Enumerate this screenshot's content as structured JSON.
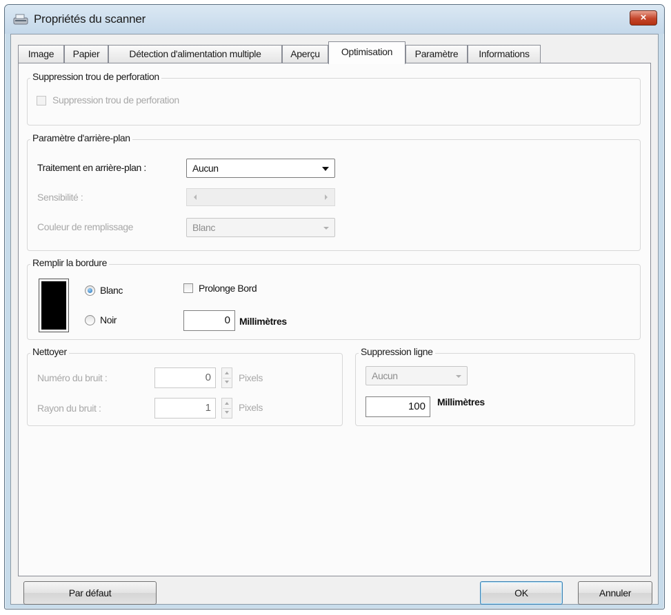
{
  "window": {
    "title": "Propriétés du scanner",
    "close_glyph": "×"
  },
  "tabs": [
    {
      "label": "Image"
    },
    {
      "label": "Papier"
    },
    {
      "label": "Détection d'alimentation multiple"
    },
    {
      "label": "Aperçu"
    },
    {
      "label": "Optimisation",
      "active": true
    },
    {
      "label": "Paramètre"
    },
    {
      "label": "Informations"
    }
  ],
  "hole_removal": {
    "legend": "Suppression trou de perforation",
    "checkbox_label": "Suppression trou de perforation",
    "checked": false,
    "enabled": false
  },
  "background": {
    "legend": "Paramètre d'arrière-plan",
    "processing_label": "Traitement en arrière-plan :",
    "processing_value": "Aucun",
    "sensitivity_label": "Sensibilité :",
    "fill_color_label": "Couleur de remplissage",
    "fill_color_value": "Blanc"
  },
  "border_fill": {
    "legend": "Remplir la bordure",
    "option_white": "Blanc",
    "option_black": "Noir",
    "selected": "Blanc",
    "extend_label": "Prolonge Bord",
    "extend_checked": false,
    "value": "0",
    "unit": "Millimètres"
  },
  "cleanup": {
    "legend": "Nettoyer",
    "noise_number_label": "Numéro du bruit :",
    "noise_number_value": "0",
    "noise_number_unit": "Pixels",
    "noise_radius_label": "Rayon du bruit :",
    "noise_radius_value": "1",
    "noise_radius_unit": "Pixels"
  },
  "line_removal": {
    "legend": "Suppression ligne",
    "value": "Aucun",
    "length": "100",
    "unit": "Millimètres"
  },
  "buttons": {
    "defaults": "Par défaut",
    "ok": "OK",
    "cancel": "Annuler"
  },
  "colors": {
    "accent": "#3c7fb1",
    "close_button": "#c4452a",
    "disabled_text": "#a8a8a8"
  }
}
